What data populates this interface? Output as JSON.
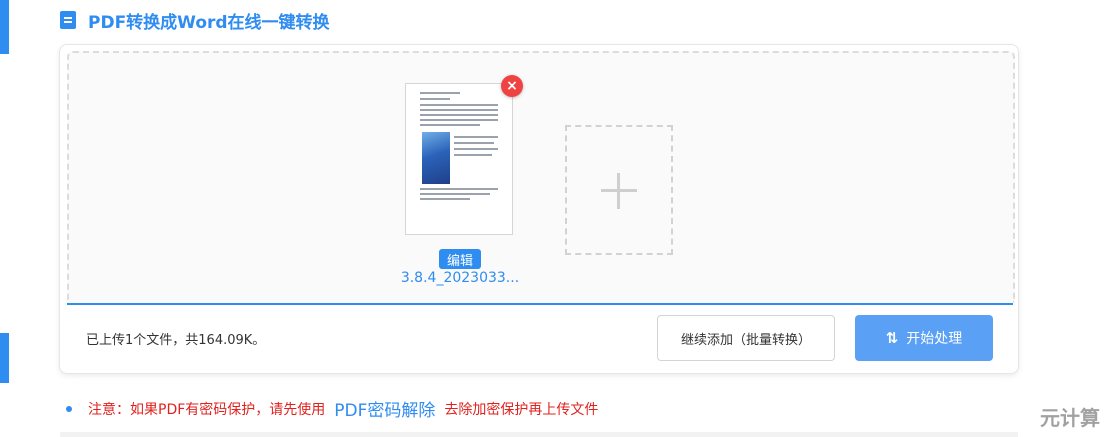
{
  "header": {
    "title": "PDF转换成Word在线一键转换",
    "icon": "document-icon"
  },
  "upload_card": {
    "file": {
      "name": "3.8.4_2023033...",
      "edit_label": "编辑",
      "remove_icon": "close-icon",
      "remove_glyph": "×"
    },
    "add_more_icon": "plus-icon",
    "status_text": "已上传1个文件，共164.09K。",
    "continue_label": "继续添加（批量转换）",
    "start_label": "开始处理",
    "start_icon": "swap-icon",
    "start_glyph": "⇅"
  },
  "notice": {
    "prefix": "注意：如果PDF有密码保护，请先使用",
    "link": "PDF密码解除",
    "suffix": "去除加密保护再上传文件"
  },
  "watermark": "元计算",
  "colors": {
    "accent": "#2f8cf0",
    "start_button": "#5aa0f5",
    "danger": "#ef4343",
    "notice_text": "#e0221f"
  }
}
